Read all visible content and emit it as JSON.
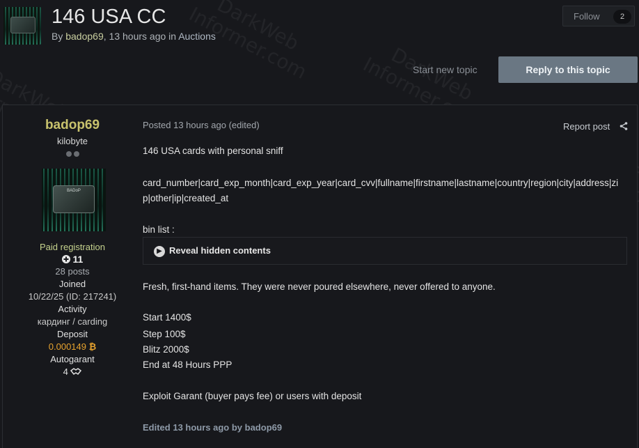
{
  "topic": {
    "title": "146 USA CC",
    "by_prefix": "By",
    "author": "badop69",
    "time": "13 hours ago",
    "in_prefix": "in",
    "forum": "Auctions",
    "follow_label": "Follow",
    "follow_count": "2",
    "start_new_topic": "Start new topic",
    "reply_label": "Reply to this topic"
  },
  "author": {
    "name": "badop69",
    "title": "kilobyte",
    "group": "Paid registration",
    "reputation": "11",
    "posts": "28 posts",
    "joined_label": "Joined",
    "joined_value": "10/22/25 (ID: 217241)",
    "activity_label": "Activity",
    "activity_value": "кардинг / carding",
    "deposit_label": "Deposit",
    "deposit_value": "0.000149",
    "autogarant_label": "Autogarant",
    "autogarant_value": "4",
    "avatar_card_text": "BADoP"
  },
  "post": {
    "posted": "Posted 13 hours ago (edited)",
    "report": "Report post",
    "lines": [
      "146 USA cards with personal sniff",
      "card_number|card_exp_month|card_exp_year|card_cvv|fullname|firstname|lastname|country|region|city|address|zi",
      "p|other|ip|created_at",
      "bin list :",
      "Fresh, first-hand items. They were never poured elsewhere, never offered to anyone.",
      "Start 1400$",
      "Step 100$",
      "Blitz 2000$",
      "End at 48 Hours PPP",
      "Exploit Garant (buyer pays fee) or users with deposit"
    ],
    "spoiler_label": "Reveal hidden contents",
    "edited": "Edited 13 hours ago by badop69"
  },
  "watermark": "DarkWeb\nInformer.com",
  "colors": {
    "background": "#17181c",
    "author_name": "#c8c26d",
    "reply_button": "#6a7783",
    "deposit": "#e8a32e",
    "group": "#c6d38e"
  },
  "icons": [
    "share-icon",
    "chevron-right-icon",
    "plus-circle-icon",
    "bitcoin-icon",
    "handshake-icon"
  ]
}
